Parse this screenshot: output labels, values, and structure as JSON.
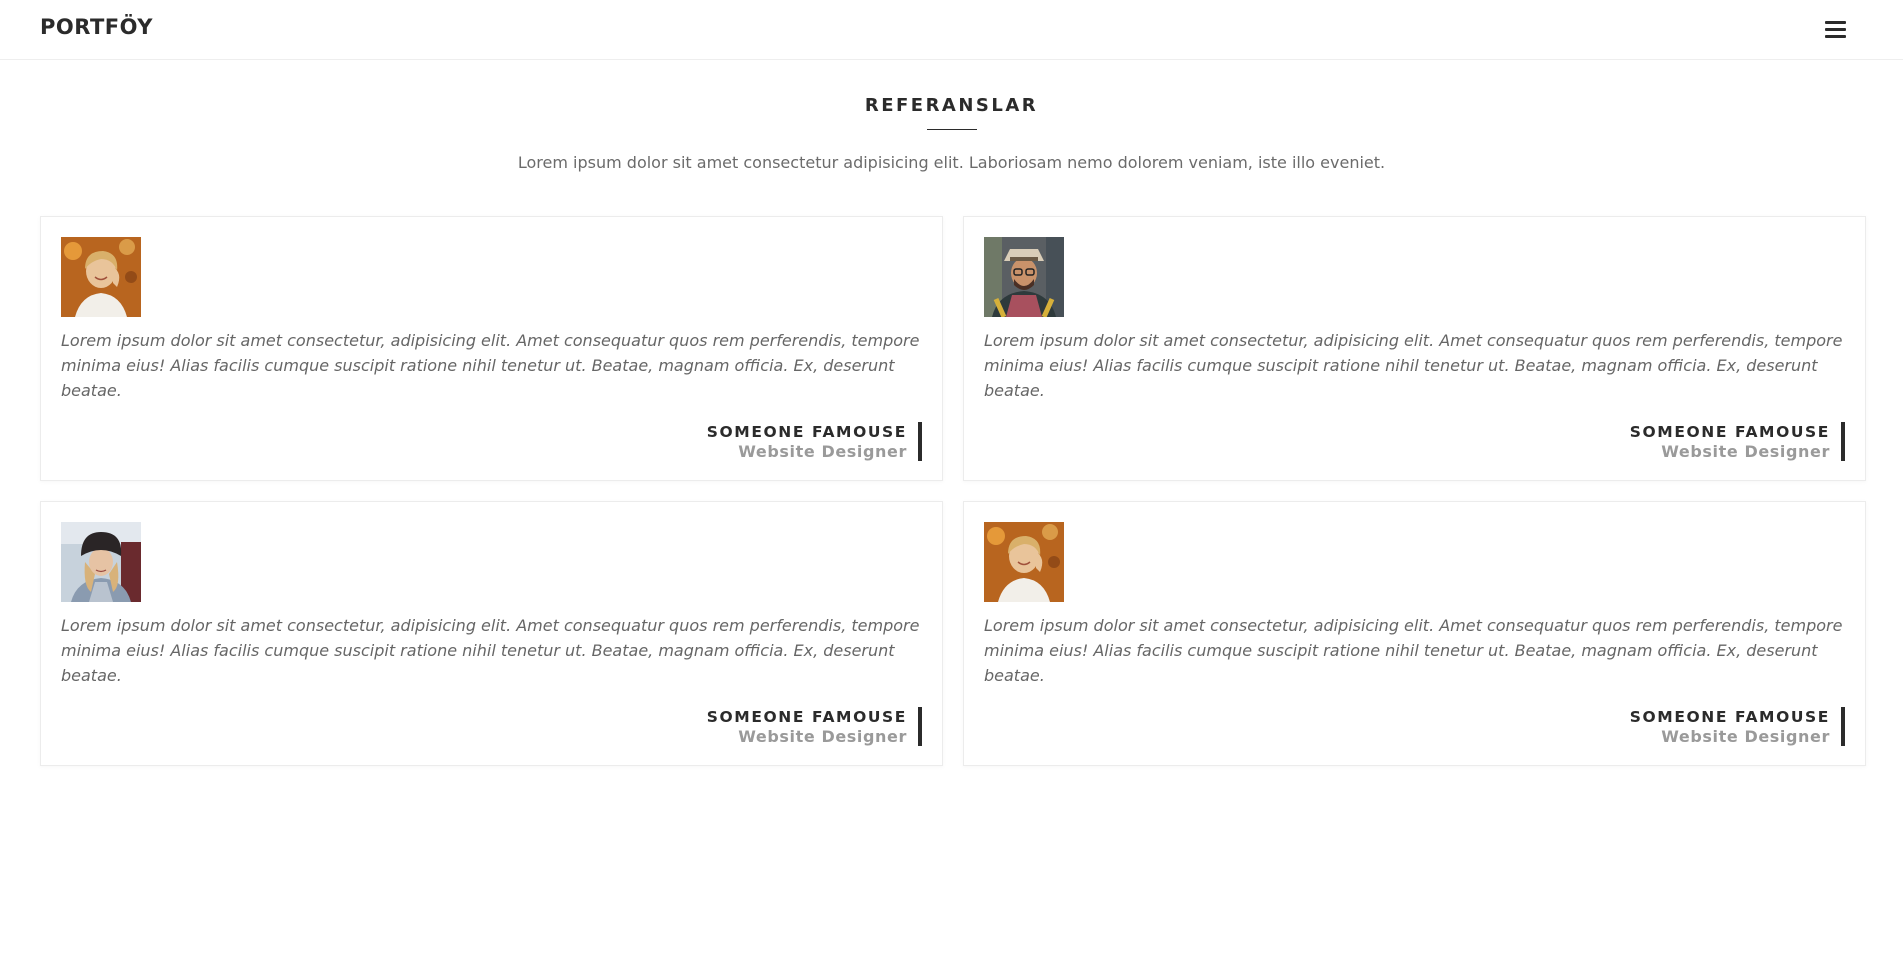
{
  "nav": {
    "brand": "PORTFÖY",
    "menu_icon": "hamburger-menu-icon"
  },
  "section": {
    "title": "REFERANSLAR",
    "subtitle": "Lorem ipsum dolor sit amet consectetur adipisicing elit. Laboriosam nemo dolorem veniam, iste illo eveniet."
  },
  "testimonials": [
    {
      "quote": "Lorem ipsum dolor sit amet consectetur, adipisicing elit. Amet consequatur quos rem perferendis, tempore minima eius! Alias facilis cumque suscipit ratione nihil tenetur ut. Beatae, magnam officia. Ex, deserunt beatae.",
      "name": "SOMEONE FAMOUSE",
      "role": "Website Designer",
      "avatar": "woman-blonde-smiling-avatar"
    },
    {
      "quote": "Lorem ipsum dolor sit amet consectetur, adipisicing elit. Amet consequatur quos rem perferendis, tempore minima eius! Alias facilis cumque suscipit ratione nihil tenetur ut. Beatae, magnam officia. Ex, deserunt beatae.",
      "name": "SOMEONE FAMOUSE",
      "role": "Website Designer",
      "avatar": "man-hat-glasses-avatar"
    },
    {
      "quote": "Lorem ipsum dolor sit amet consectetur, adipisicing elit. Amet consequatur quos rem perferendis, tempore minima eius! Alias facilis cumque suscipit ratione nihil tenetur ut. Beatae, magnam officia. Ex, deserunt beatae.",
      "name": "SOMEONE FAMOUSE",
      "role": "Website Designer",
      "avatar": "woman-beanie-avatar"
    },
    {
      "quote": "Lorem ipsum dolor sit amet consectetur, adipisicing elit. Amet consequatur quos rem perferendis, tempore minima eius! Alias facilis cumque suscipit ratione nihil tenetur ut. Beatae, magnam officia. Ex, deserunt beatae.",
      "name": "SOMEONE FAMOUSE",
      "role": "Website Designer",
      "avatar": "woman-blonde-smiling-avatar"
    }
  ],
  "colors": {
    "text_dark": "#2b2b2b",
    "text_body": "#666666",
    "text_muted": "#9a9a9a",
    "border": "#ececec"
  }
}
